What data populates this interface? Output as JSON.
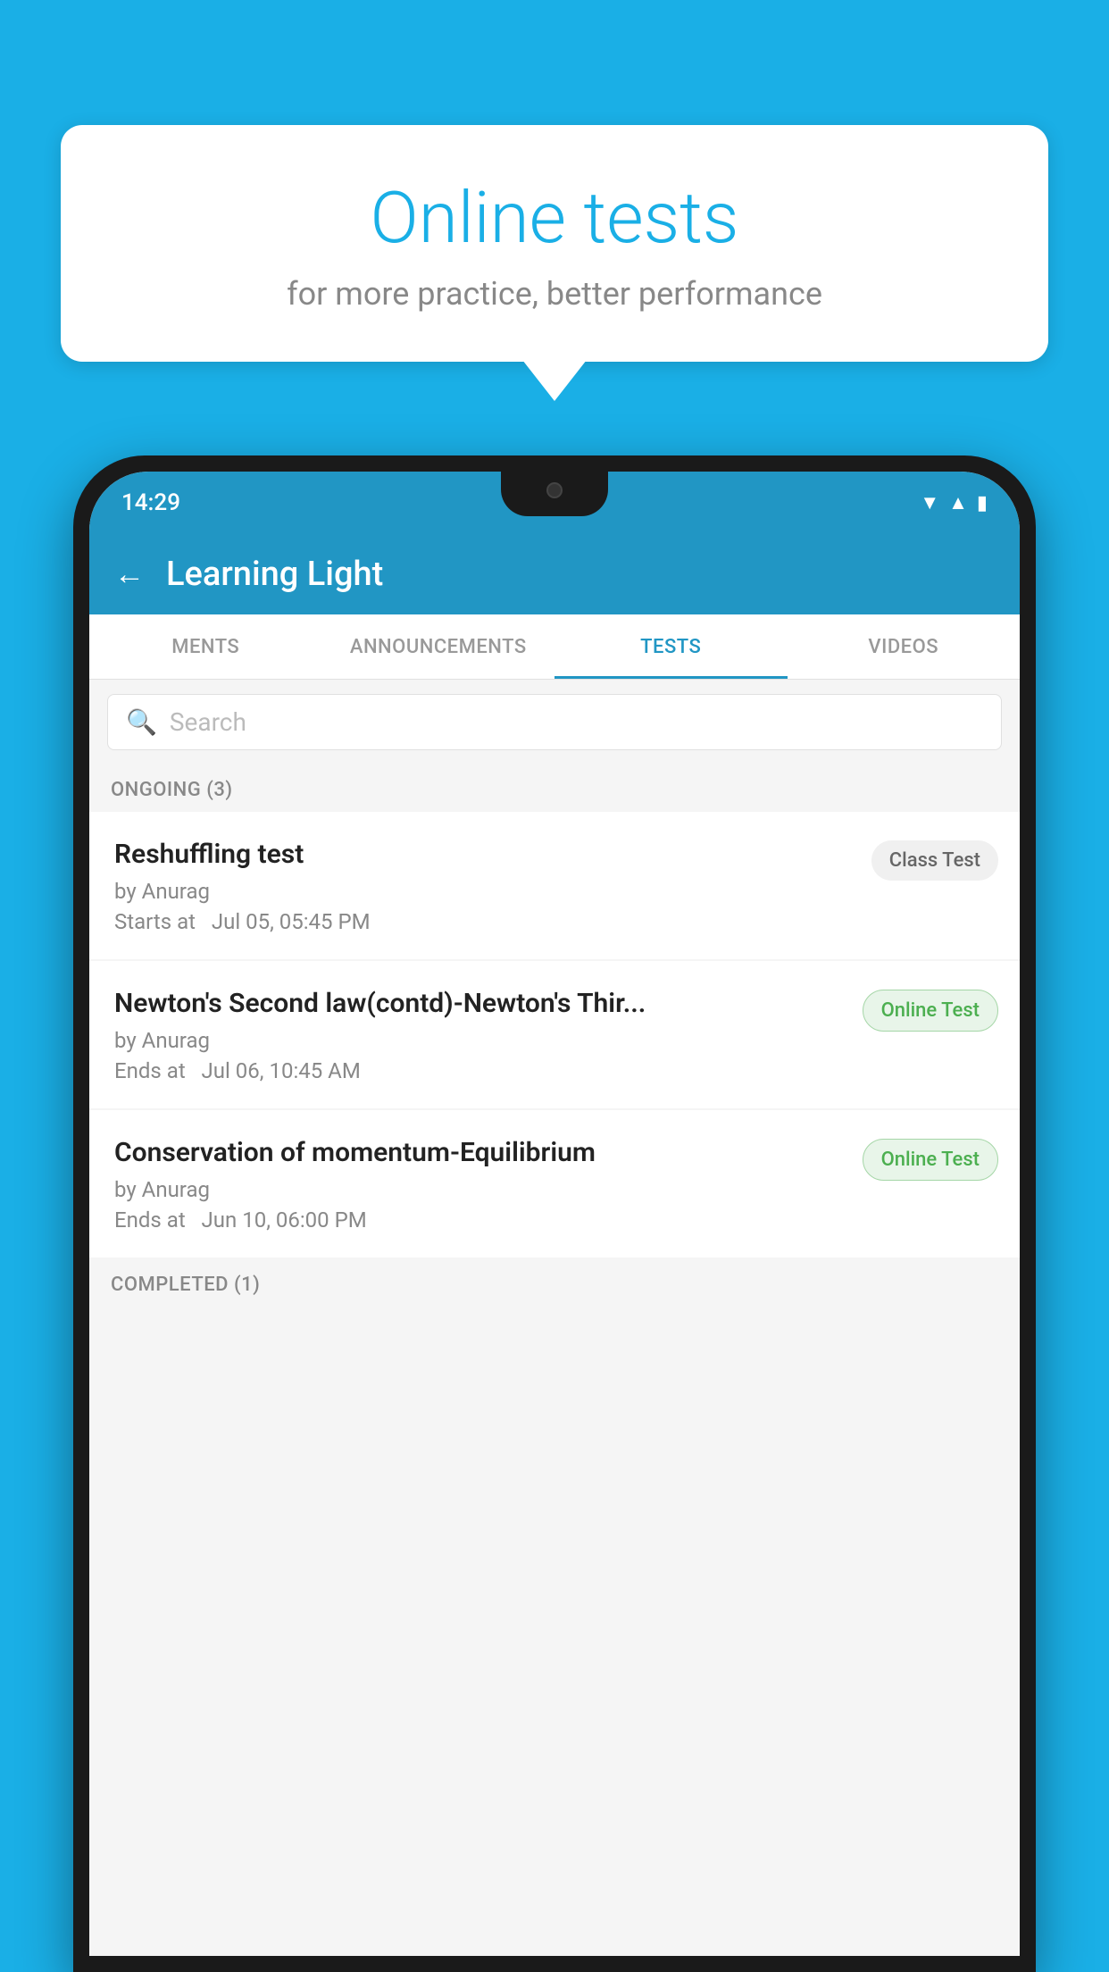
{
  "background_color": "#1AAFE6",
  "bubble": {
    "title": "Online tests",
    "subtitle": "for more practice, better performance"
  },
  "status_bar": {
    "time": "14:29",
    "wifi_icon": "▼",
    "signal_icon": "▲",
    "battery_icon": "▮"
  },
  "app_bar": {
    "back_label": "←",
    "title": "Learning Light"
  },
  "tabs": [
    {
      "label": "MENTS",
      "active": false
    },
    {
      "label": "ANNOUNCEMENTS",
      "active": false
    },
    {
      "label": "TESTS",
      "active": true
    },
    {
      "label": "VIDEOS",
      "active": false
    }
  ],
  "search": {
    "placeholder": "Search"
  },
  "section_ongoing": {
    "label": "ONGOING (3)"
  },
  "tests": [
    {
      "name": "Reshuffling test",
      "author": "by Anurag",
      "date_label": "Starts at",
      "date": "Jul 05, 05:45 PM",
      "badge": "Class Test",
      "badge_type": "class"
    },
    {
      "name": "Newton's Second law(contd)-Newton's Thir...",
      "author": "by Anurag",
      "date_label": "Ends at",
      "date": "Jul 06, 10:45 AM",
      "badge": "Online Test",
      "badge_type": "online"
    },
    {
      "name": "Conservation of momentum-Equilibrium",
      "author": "by Anurag",
      "date_label": "Ends at",
      "date": "Jun 10, 06:00 PM",
      "badge": "Online Test",
      "badge_type": "online"
    }
  ],
  "section_completed": {
    "label": "COMPLETED (1)"
  }
}
